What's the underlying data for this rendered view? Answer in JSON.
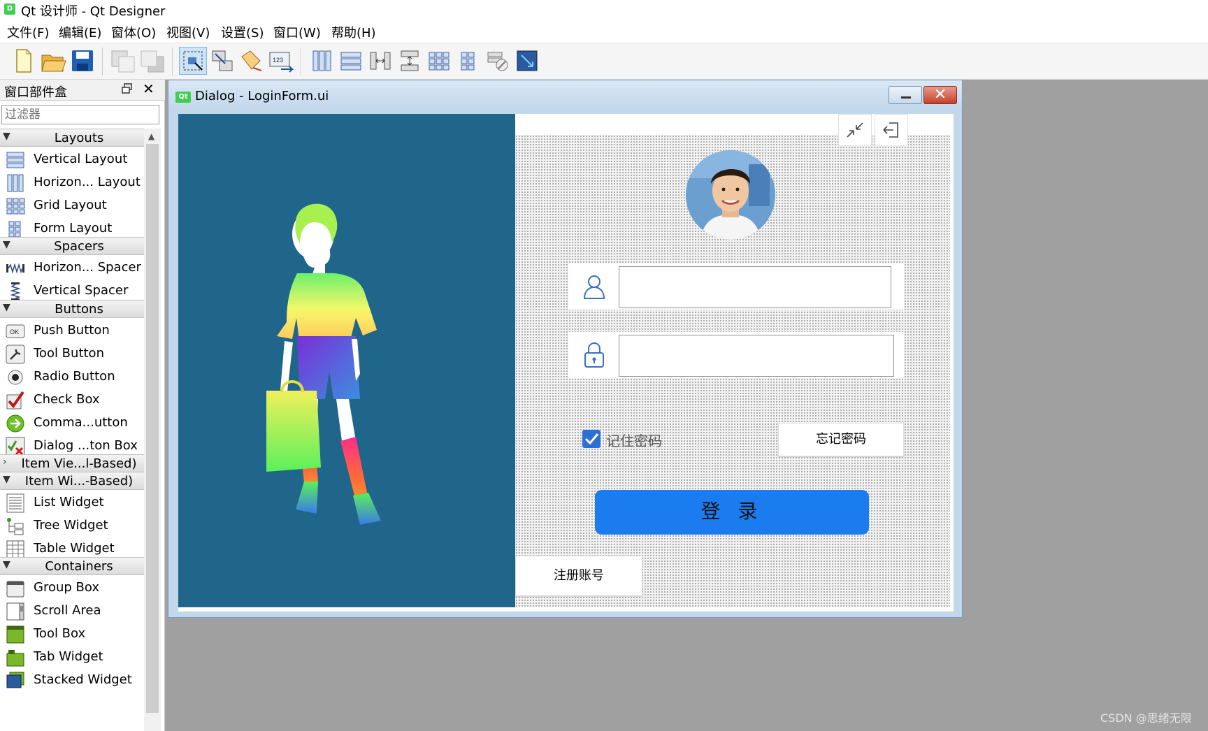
{
  "app": {
    "icon_text": "D",
    "title": "Qt 设计师 - Qt Designer"
  },
  "menu": [
    "文件(F)",
    "编辑(E)",
    "窗体(O)",
    "视图(V)",
    "设置(S)",
    "窗口(W)",
    "帮助(H)"
  ],
  "widgetbox": {
    "title": "窗口部件盒",
    "filter_placeholder": "过滤器",
    "categories": {
      "layouts": "Layouts",
      "spacers": "Spacers",
      "buttons": "Buttons",
      "item_views": "Item Vie...l-Based)",
      "item_widgets": "Item Wi...-Based)",
      "containers": "Containers"
    },
    "items": {
      "vertical_layout": "Vertical Layout",
      "horizontal_layout": "Horizon... Layout",
      "grid_layout": "Grid Layout",
      "form_layout": "Form Layout",
      "horizontal_spacer": "Horizon... Spacer",
      "vertical_spacer": "Vertical Spacer",
      "push_button": "Push Button",
      "tool_button": "Tool Button",
      "radio_button": "Radio Button",
      "check_box": "Check Box",
      "command_link": "Comma...utton",
      "dialog_button_box": "Dialog ...ton Box",
      "list_widget": "List Widget",
      "tree_widget": "Tree Widget",
      "table_widget": "Table Widget",
      "group_box": "Group Box",
      "scroll_area": "Scroll Area",
      "tool_box": "Tool Box",
      "tab_widget": "Tab Widget",
      "stacked_widget": "Stacked Widget"
    },
    "icon_texts": {
      "push_button": "OK"
    }
  },
  "dialog": {
    "qt_badge": "Qt",
    "title": "Dialog - LoginForm.ui",
    "remember_label": "记住密码",
    "forget_label": "忘记密码",
    "login_label": "登 录",
    "register_label": "注册账号",
    "remember_checked": true
  },
  "watermark": "CSDN @思绪无限",
  "colors": {
    "left_panel": "#20658a",
    "login_button": "#1b7cf0",
    "checkbox": "#2e6fd6",
    "icon_blue": "#3a6fc4"
  }
}
